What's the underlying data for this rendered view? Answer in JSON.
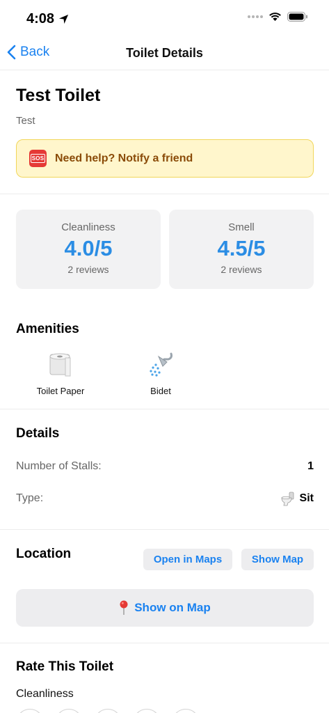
{
  "status_bar": {
    "time": "4:08"
  },
  "nav": {
    "back_label": "Back",
    "title": "Toilet Details"
  },
  "toilet": {
    "name": "Test Toilet",
    "description": "Test"
  },
  "sos": {
    "badge": "SOS",
    "text": "Need help? Notify a friend"
  },
  "ratings": [
    {
      "label": "Cleanliness",
      "value": "4.0/5",
      "reviews": "2 reviews"
    },
    {
      "label": "Smell",
      "value": "4.5/5",
      "reviews": "2 reviews"
    }
  ],
  "amenities": {
    "title": "Amenities",
    "items": [
      {
        "label": "Toilet Paper",
        "icon": "toilet-paper-icon"
      },
      {
        "label": "Bidet",
        "icon": "shower-head-icon"
      }
    ]
  },
  "details": {
    "title": "Details",
    "rows": [
      {
        "label": "Number of Stalls:",
        "value": "1"
      },
      {
        "label": "Type:",
        "value": "Sit",
        "icon": "toilet-icon"
      }
    ]
  },
  "location": {
    "title": "Location",
    "open_in_maps": "Open in Maps",
    "show_map": "Show Map",
    "show_on_map": "Show on Map"
  },
  "rate": {
    "title": "Rate This Toilet",
    "cleanliness_label": "Cleanliness"
  },
  "colors": {
    "accent": "#1a82f0",
    "rating": "#2b8de4",
    "sos_bg": "#fff6cc",
    "sos_border": "#f1d65a",
    "sos_text": "#8a4b08"
  }
}
